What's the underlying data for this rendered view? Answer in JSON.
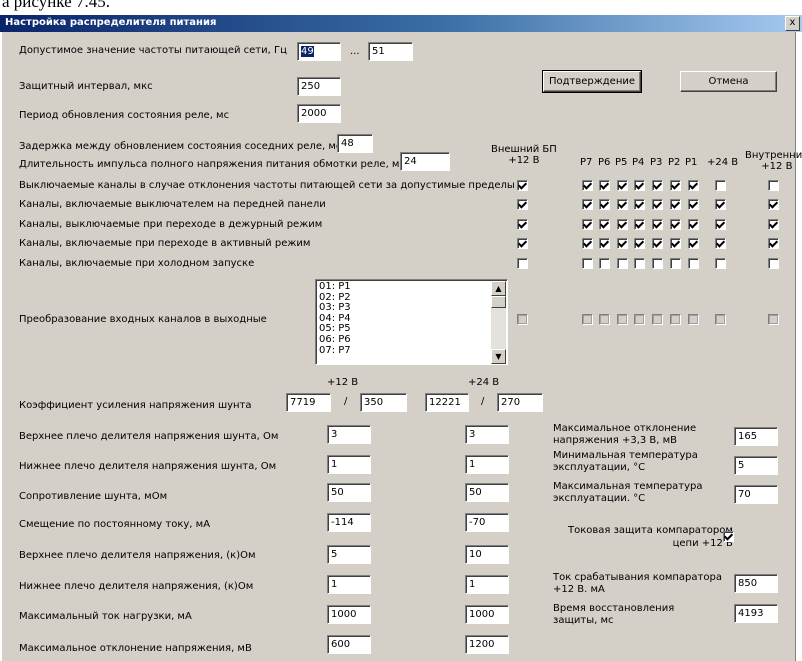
{
  "page_caption": "а рисунке 7.45.",
  "window": {
    "title": "Настройка распределителя питания",
    "close_glyph": "x"
  },
  "freq": {
    "label": "Допустимое значение частоты питающей сети, Гц",
    "min": "49",
    "sep": "...",
    "max": "51"
  },
  "guard": {
    "label": "Защитный интервал, мкс",
    "value": "250"
  },
  "relay_period": {
    "label": "Период обновления состояния реле, мс",
    "value": "2000"
  },
  "relay_delay": {
    "label": "Задержка между обновлением состояния соседних реле, мс",
    "value": "48"
  },
  "pulse": {
    "label": "Длительность импульса полного напряжения питания обмотки реле, мс",
    "value": "24"
  },
  "buttons": {
    "confirm": "Подтверждение",
    "cancel": "Отмена"
  },
  "columns": {
    "ext": "Внешний БП\n+12 В",
    "p7": "P7",
    "p6": "P6",
    "p5": "P5",
    "p4": "P4",
    "p3": "P3",
    "p2": "P2",
    "p1": "P1",
    "v24": "+24 В",
    "int": "Внутренний\n+12 В"
  },
  "channel_rows": [
    {
      "label": "Выключаемые каналы в случае отклонения частоты питающей сети за допустимые пределы",
      "ext": true,
      "p": [
        true,
        true,
        true,
        true,
        true,
        true,
        true
      ],
      "v24": false,
      "int": false
    },
    {
      "label": "Каналы, включаемые выключателем на передней панели",
      "ext": true,
      "p": [
        true,
        true,
        true,
        true,
        true,
        true,
        true
      ],
      "v24": true,
      "int": true
    },
    {
      "label": "Каналы, выключаемые при переходе в дежурный режим",
      "ext": true,
      "p": [
        true,
        true,
        true,
        true,
        true,
        true,
        true
      ],
      "v24": true,
      "int": true
    },
    {
      "label": "Каналы, включаемые при переходе в активный режим",
      "ext": true,
      "p": [
        true,
        true,
        true,
        true,
        true,
        true,
        true
      ],
      "v24": true,
      "int": true
    },
    {
      "label": "Каналы, включаемые при холодном запуске",
      "ext": false,
      "p": [
        false,
        false,
        false,
        false,
        false,
        false,
        false
      ],
      "v24": false,
      "int": false
    }
  ],
  "conversion": {
    "label": "Преобразование входных каналов в выходные",
    "items": [
      "01: P1",
      "02: P2",
      "03: P3",
      "04: P4",
      "05: P5",
      "06: P6",
      "07: P7"
    ]
  },
  "shunt_header": {
    "v12": "+12 В",
    "v24": "+24 В"
  },
  "shunt_gain": {
    "label": "Коэффициент усиления напряжения шунта",
    "a12": "7719",
    "b12": "350",
    "a24": "12221",
    "b24": "270",
    "slash": "/"
  },
  "param_rows": [
    {
      "label": "Верхнее плечо делителя напряжения шунта, Ом",
      "v12": "3",
      "v24": "3"
    },
    {
      "label": "Нижнее плечо делителя напряжения шунта, Ом",
      "v12": "1",
      "v24": "1"
    },
    {
      "label": "Сопротивление шунта, мОм",
      "v12": "50",
      "v24": "50"
    },
    {
      "label": "Смещение по постоянному току, мА",
      "v12": "-114",
      "v24": "-70"
    },
    {
      "label": "Верхнее плечо делителя напряжения, (к)Ом",
      "v12": "5",
      "v24": "10"
    },
    {
      "label": "Нижнее плечо делителя напряжения, (к)Ом",
      "v12": "1",
      "v24": "1"
    },
    {
      "label": "Максимальный ток нагрузки, мА",
      "v12": "1000",
      "v24": "1000"
    },
    {
      "label": "Максимальное отклонение напряжения, мВ",
      "v12": "600",
      "v24": "1200"
    }
  ],
  "right": {
    "dev33": {
      "label1": "Максимальное отклонение",
      "label2": "напряжения +3,3 В, мВ",
      "value": "165"
    },
    "tmin": {
      "label1": "Минимальная температура",
      "label2": "эксплуатации, °С",
      "value": "5"
    },
    "tmax": {
      "label1": "Максимальная температура",
      "label2": "эксплуатации. °С",
      "value": "70"
    },
    "cmp": {
      "label1": "Токовая защита компаратором",
      "label2": "цепи +12 В",
      "checked": true
    },
    "trip": {
      "label1": "Ток срабатывания компаратора",
      "label2": "+12 В. мА",
      "value": "850"
    },
    "recover": {
      "label1": "Время восстановления",
      "label2": "защиты, мс",
      "value": "4193"
    }
  }
}
